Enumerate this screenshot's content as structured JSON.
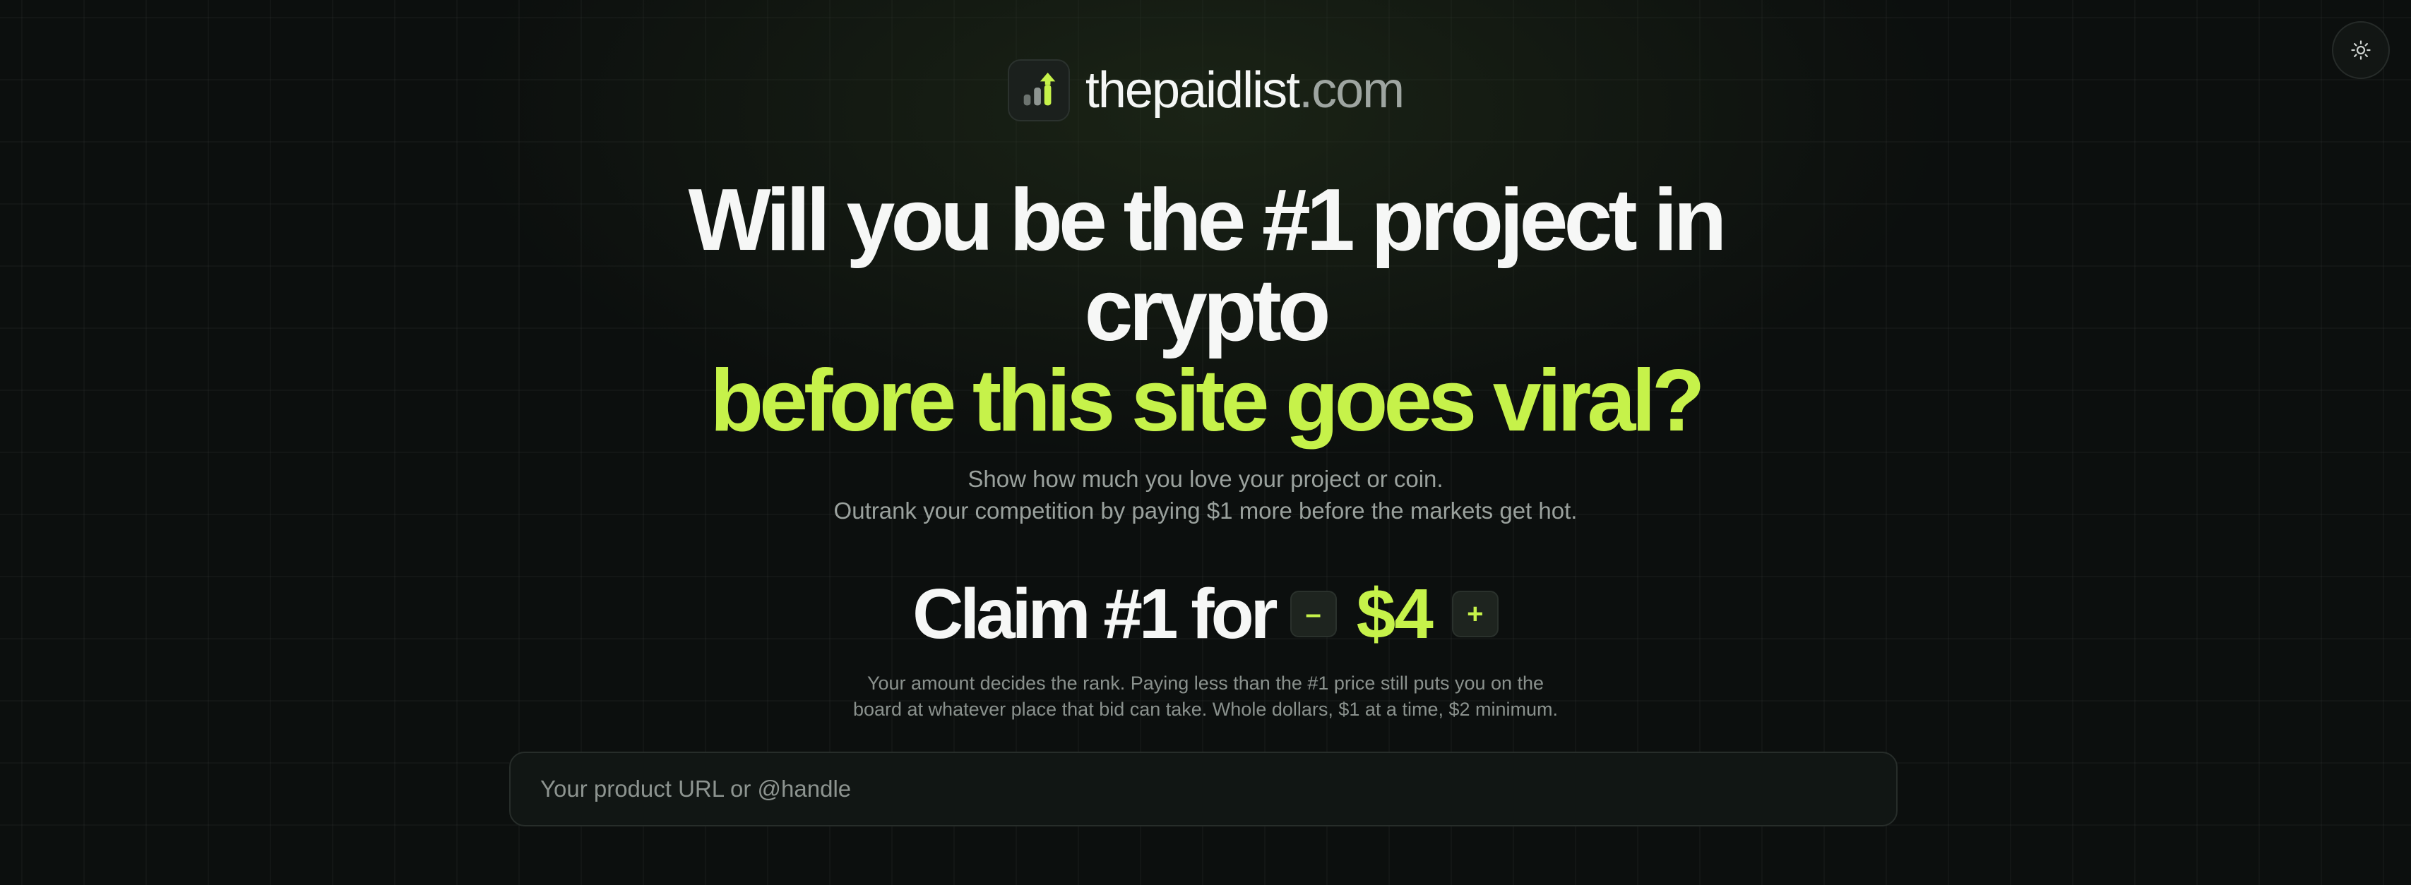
{
  "brand": {
    "name_main": "thepaidlist",
    "name_tld": ".com",
    "logo_icon": "bar-chart-arrow-icon",
    "accent_color": "#c6f24a"
  },
  "theme_toggle": {
    "icon": "sun-icon"
  },
  "hero": {
    "line1": "Will you be the #1 project in",
    "line2": "crypto",
    "line3": "before this site goes viral?"
  },
  "subtitle": {
    "line1": "Show how much you love your project or coin.",
    "line2": "Outrank your competition by paying $1 more before the markets get hot."
  },
  "claim": {
    "label": "Claim #1 for",
    "decrement_label": "–",
    "price": "$4",
    "increment_label": "+"
  },
  "note": {
    "line1": "Your amount decides the rank. Paying less than the #1 price still puts you on the",
    "line2": "board at whatever place that bid can take. Whole dollars, $1 at a time, $2 minimum."
  },
  "url_input": {
    "value": "",
    "placeholder": "Your product URL or @handle"
  }
}
